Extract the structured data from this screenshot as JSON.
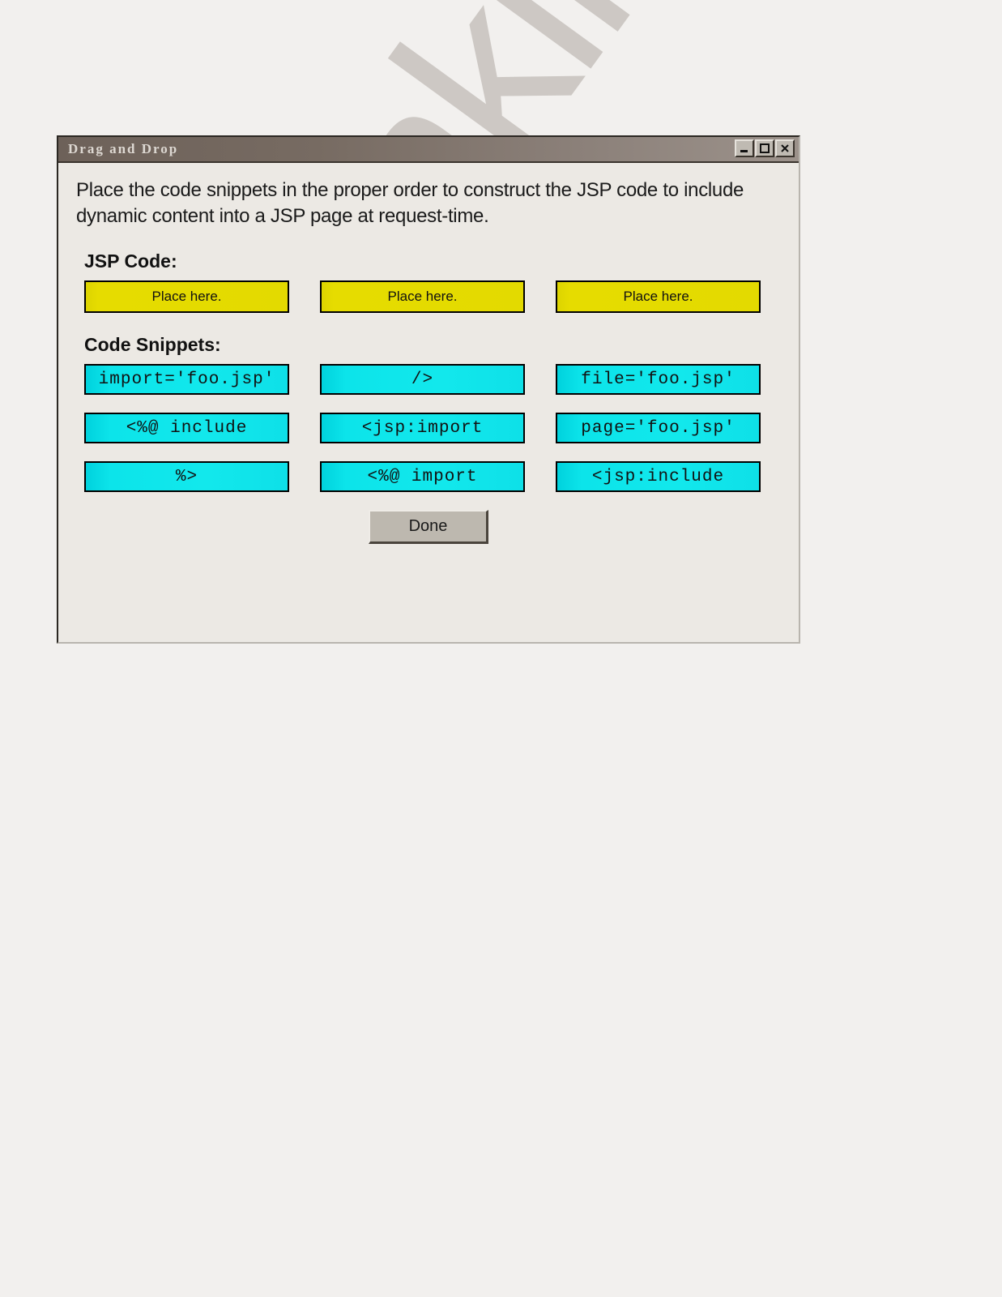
{
  "watermark": {
    "text": "Examkiller.com",
    "color": "#786c64"
  },
  "dialog": {
    "title": "Drag and Drop",
    "window_controls": [
      {
        "name": "minimize",
        "icon": "minimize-icon"
      },
      {
        "name": "maximize",
        "icon": "maximize-icon"
      },
      {
        "name": "close",
        "icon": "close-icon"
      }
    ],
    "instruction": "Place the code snippets in the proper order to construct the JSP code to include dynamic content into a JSP page at request-time.",
    "jsp_code": {
      "label": "JSP Code:",
      "slot_color": "#e3da00",
      "slots": [
        {
          "label": "Place here."
        },
        {
          "label": "Place here."
        },
        {
          "label": "Place here."
        }
      ]
    },
    "code_snippets": {
      "label": "Code Snippets:",
      "chip_color": "#12e8ec",
      "rows": [
        [
          {
            "label": "import='foo.jsp'"
          },
          {
            "label": "/>"
          },
          {
            "label": "file='foo.jsp'"
          }
        ],
        [
          {
            "label": "<%@ include"
          },
          {
            "label": "<jsp:import"
          },
          {
            "label": "page='foo.jsp'"
          }
        ],
        [
          {
            "label": "%>"
          },
          {
            "label": "<%@ import"
          },
          {
            "label": "<jsp:include"
          }
        ]
      ]
    },
    "done_button": {
      "label": "Done"
    }
  }
}
